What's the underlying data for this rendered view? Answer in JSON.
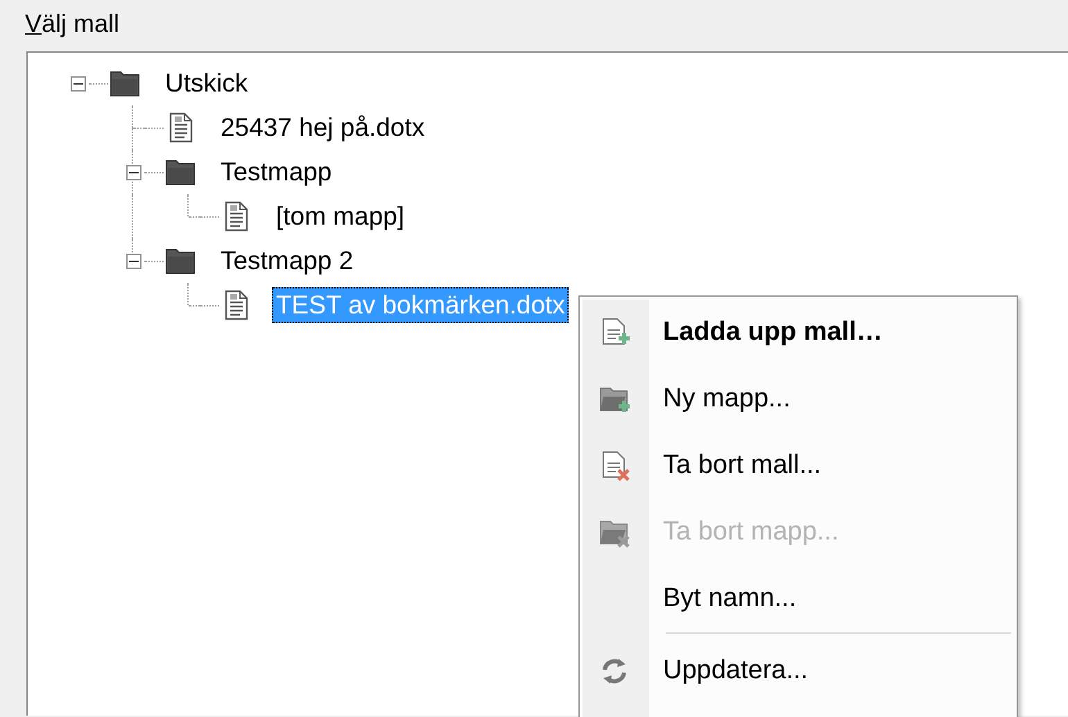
{
  "group_label": {
    "access_key": "V",
    "rest": "älj mall"
  },
  "tree": [
    {
      "label": "Utskick",
      "kind": "folder",
      "expanded": true,
      "selected": false,
      "children": [
        {
          "label": "25437 hej på.dotx",
          "kind": "file",
          "selected": false
        },
        {
          "label": "Testmapp",
          "kind": "folder",
          "expanded": true,
          "selected": false,
          "children": [
            {
              "label": "[tom mapp]",
              "kind": "file",
              "selected": false
            }
          ]
        },
        {
          "label": "Testmapp 2",
          "kind": "folder",
          "expanded": true,
          "selected": false,
          "children": [
            {
              "label": "TEST av bokmärken.dotx",
              "kind": "file",
              "selected": true
            }
          ]
        }
      ]
    }
  ],
  "context_menu": [
    {
      "kind": "upload",
      "label": "Ladda upp mall…",
      "bold": true,
      "disabled": false
    },
    {
      "kind": "newfolder",
      "label": "Ny mapp...",
      "bold": false,
      "disabled": false
    },
    {
      "kind": "deletefile",
      "label": "Ta bort mall...",
      "bold": false,
      "disabled": false
    },
    {
      "kind": "deletefolder",
      "label": "Ta bort mapp...",
      "bold": false,
      "disabled": true
    },
    {
      "kind": "rename",
      "label": "Byt namn...",
      "bold": false,
      "disabled": false
    },
    {
      "kind": "separator"
    },
    {
      "kind": "refresh",
      "label": "Uppdatera...",
      "bold": false,
      "disabled": false
    }
  ]
}
